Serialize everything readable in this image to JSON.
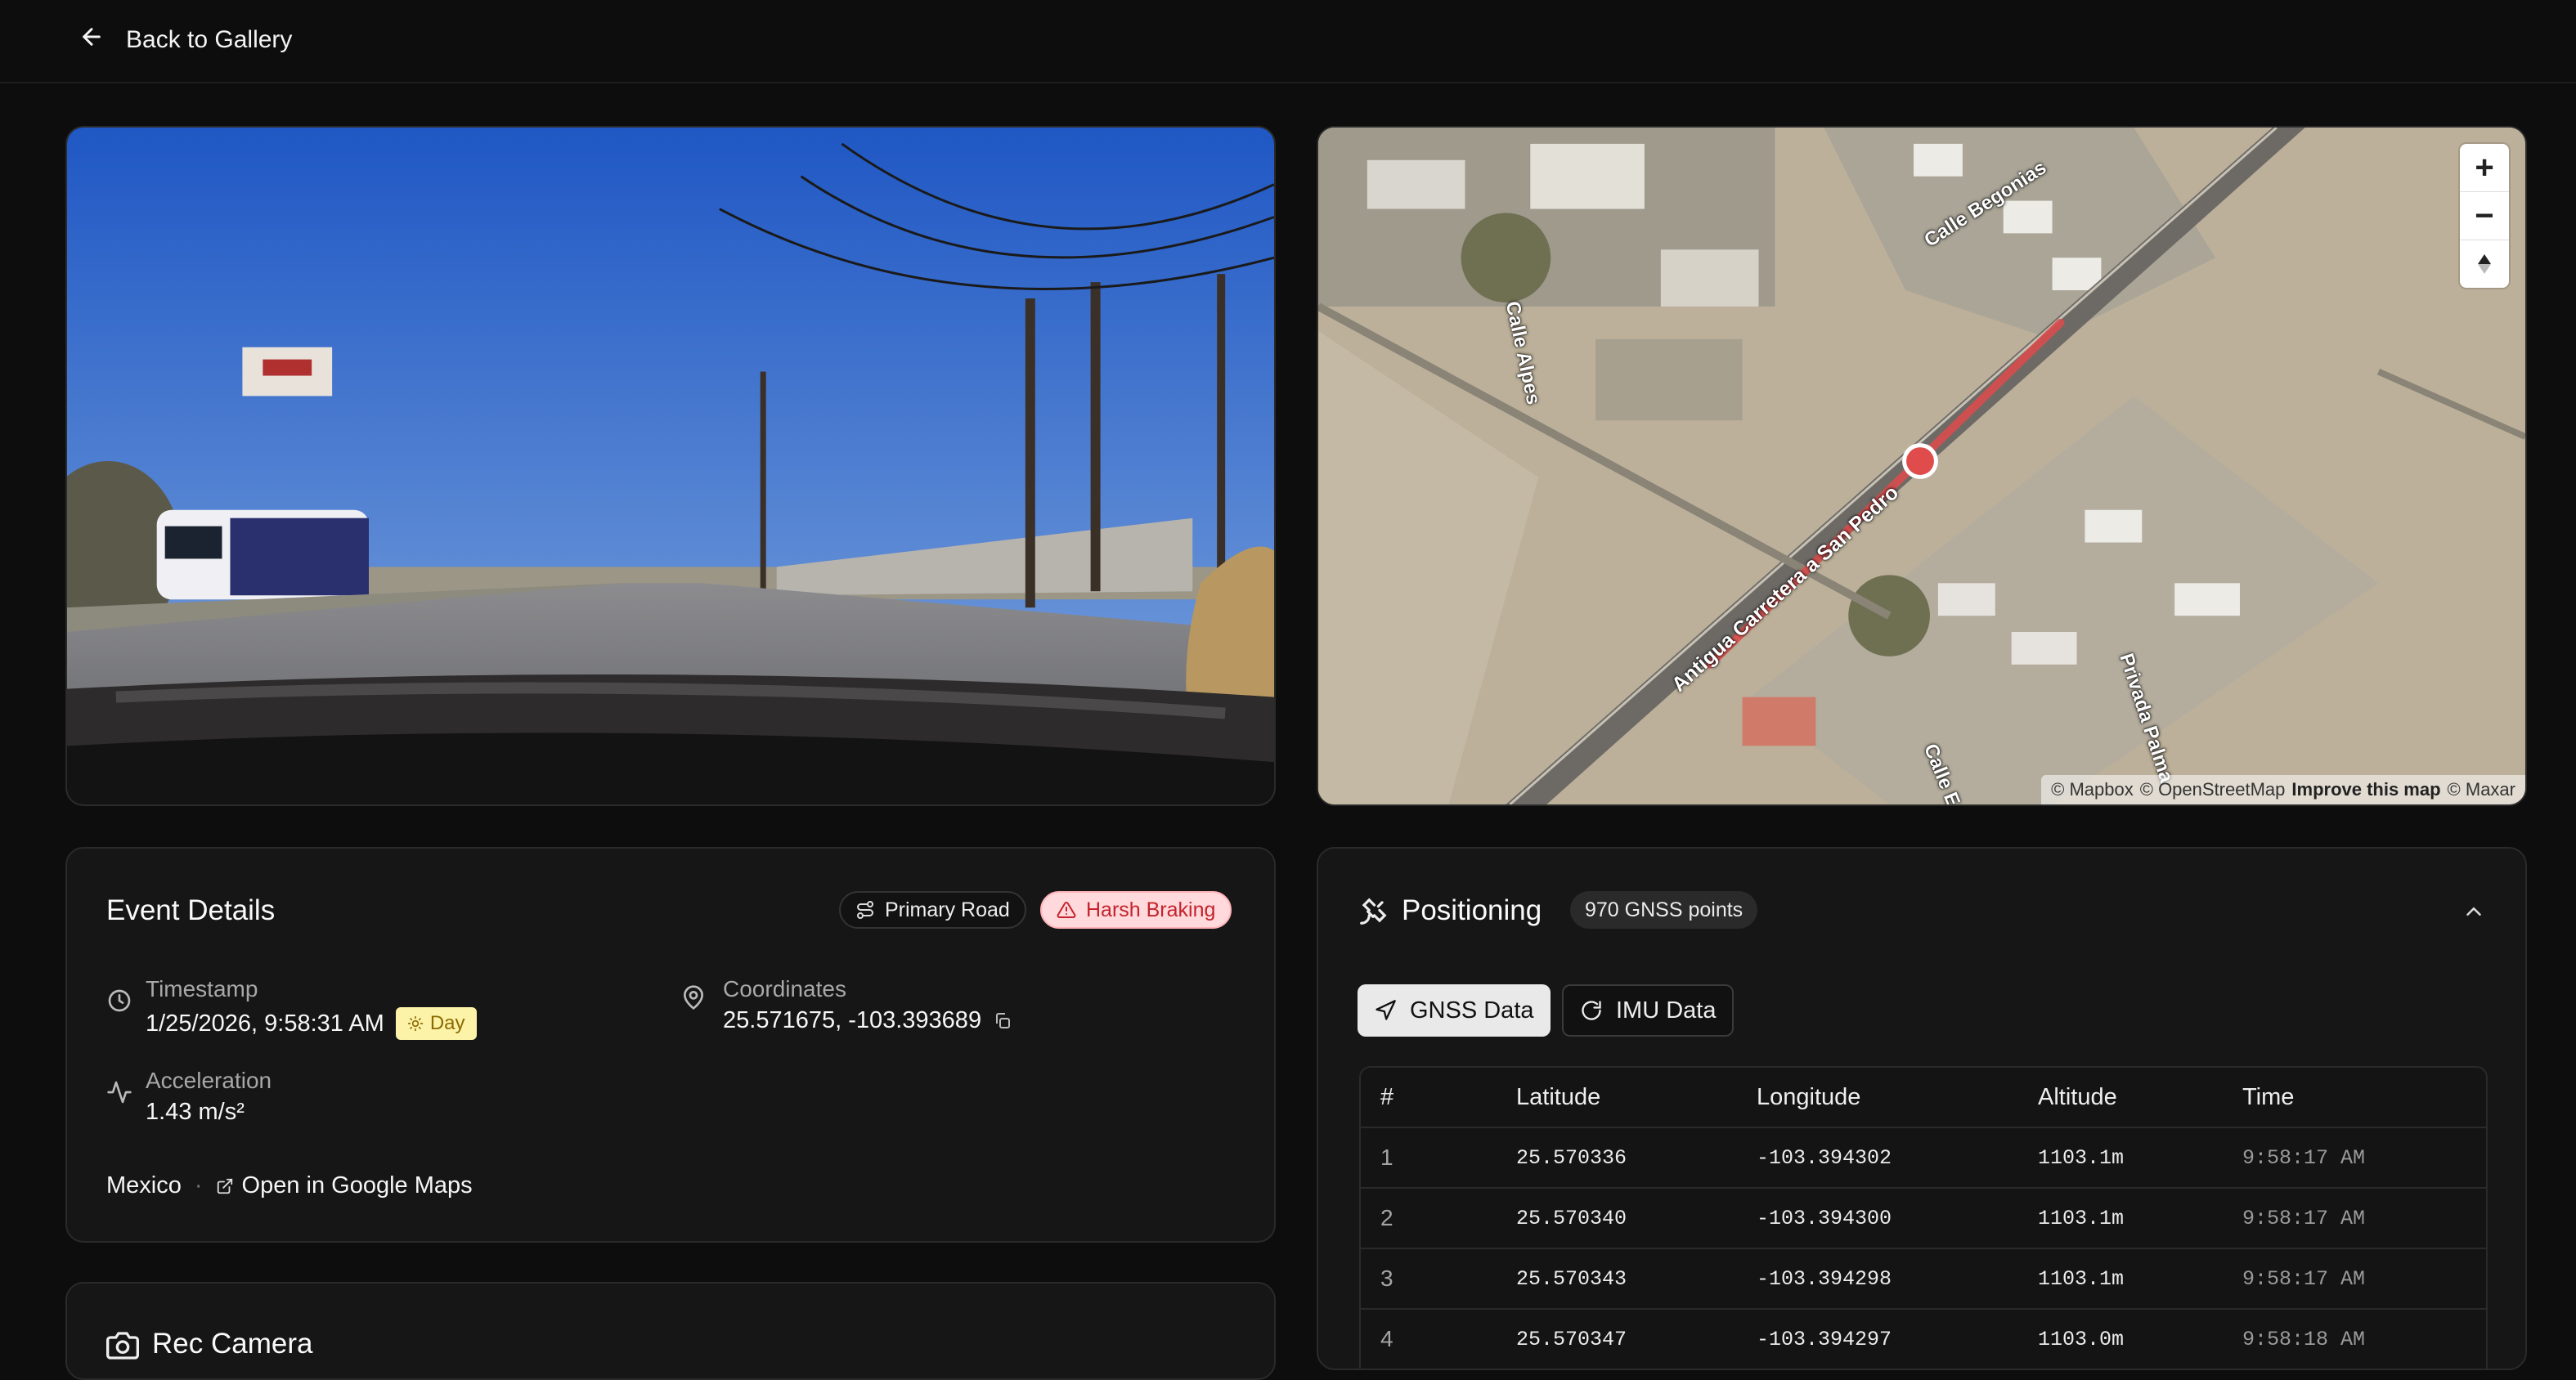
{
  "nav": {
    "back_label": "Back to Gallery"
  },
  "map": {
    "streets": [
      "Calle Begonias",
      "Calle Alpes",
      "Antigua Carretera a San Pedro",
      "Privada Palma",
      "Calle E"
    ],
    "attribution": {
      "mapbox": "© Mapbox",
      "osm": "© OpenStreetMap",
      "improve": "Improve this map",
      "maxar": "© Maxar"
    },
    "zoom_in": "+",
    "zoom_out": "−"
  },
  "event": {
    "title": "Event Details",
    "badges": {
      "road": "Primary Road",
      "event": "Harsh Braking"
    },
    "timestamp_label": "Timestamp",
    "timestamp_value": "1/25/2026, 9:58:31 AM",
    "day_label": "Day",
    "coords_label": "Coordinates",
    "coords_value": "25.571675, -103.393689",
    "accel_label": "Acceleration",
    "accel_value": "1.43 m/s²",
    "country": "Mexico",
    "separator": "·",
    "maps_link": "Open in Google Maps"
  },
  "positioning": {
    "title": "Positioning",
    "count": "970 GNSS points",
    "tabs": [
      "GNSS Data",
      "IMU Data"
    ],
    "columns": [
      "#",
      "Latitude",
      "Longitude",
      "Altitude",
      "Time"
    ],
    "rows": [
      [
        "1",
        "25.570336",
        "-103.394302",
        "1103.1m",
        "9:58:17 AM"
      ],
      [
        "2",
        "25.570340",
        "-103.394300",
        "1103.1m",
        "9:58:17 AM"
      ],
      [
        "3",
        "25.570343",
        "-103.394298",
        "1103.1m",
        "9:58:17 AM"
      ],
      [
        "4",
        "25.570347",
        "-103.394297",
        "1103.0m",
        "9:58:18 AM"
      ]
    ]
  },
  "camera_card": {
    "title": "Rec Camera"
  },
  "colors": {
    "accent_red": "#e04b4b",
    "day_bg": "#fdf3a8",
    "brake_bg": "#ffd9db"
  }
}
